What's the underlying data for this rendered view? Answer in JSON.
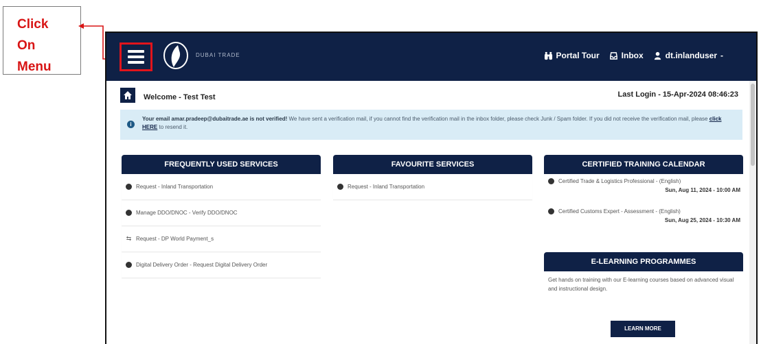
{
  "annotation": {
    "lines": [
      "Click",
      "On",
      "Menu"
    ],
    "color": "#d81414"
  },
  "topbar": {
    "logo_text": "DUBAI TRADE",
    "portal_tour": "Portal Tour",
    "inbox": "Inbox",
    "user": "dt.inlanduser",
    "bg_color": "#0f2146",
    "menu_highlight_color": "#e1141b"
  },
  "welcome": {
    "greeting": "Welcome - Test Test",
    "last_login": "Last Login - 15-Apr-2024 08:46:23"
  },
  "alert": {
    "email_msg": "Your email amar.pradeep@dubaitrade.ae is not verified!",
    "body": "We have sent a verification mail, if you cannot find the verification mail in the inbox folder, please check Junk / Spam folder. If you did not receive the verification mail, please",
    "link": "click HERE",
    "tail": "to resend it."
  },
  "frequent": {
    "title": "FREQUENTLY USED SERVICES",
    "items": [
      "Request - Inland Transportation",
      "Manage DDO/DNOC - Verify DDO/DNOC",
      "Request - DP World Payment_s",
      "Digital Delivery Order - Request Digital Delivery Order"
    ]
  },
  "favourite": {
    "title": "FAVOURITE SERVICES",
    "items": [
      "Request - Inland Transportation"
    ]
  },
  "training": {
    "title": "CERTIFIED TRAINING CALENDAR",
    "items": [
      {
        "name": "Certified Trade & Logistics Professional - (English)",
        "date": "Sun, Aug 11, 2024 - 10:00 AM"
      },
      {
        "name": "Certified Customs Expert - Assessment - (English)",
        "date": "Sun, Aug 25, 2024 - 10:30 AM"
      }
    ]
  },
  "elearning": {
    "title": "E-LEARNING PROGRAMMES",
    "desc": "Get hands on training with our E-learning courses based on advanced visual and instructional design.",
    "button": "LEARN MORE"
  }
}
